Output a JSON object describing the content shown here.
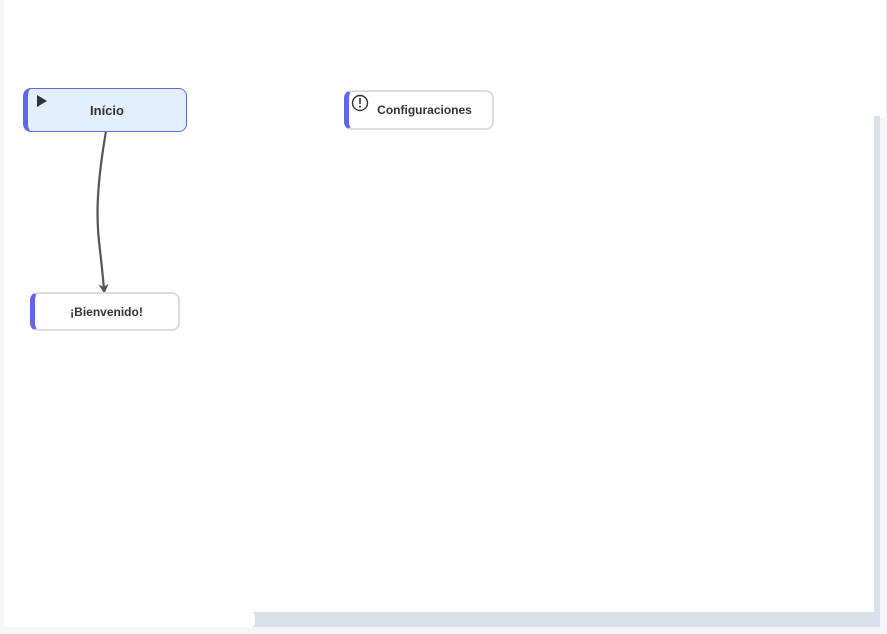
{
  "diagram": {
    "nodes": [
      {
        "id": "start",
        "label": "Início",
        "icon": "play-icon",
        "type": "start"
      },
      {
        "id": "settings",
        "label": "Configuraciones",
        "icon": "alert-circle-icon",
        "type": "block"
      },
      {
        "id": "welcome",
        "label": "¡Bienvenido!",
        "icon": "",
        "type": "block"
      }
    ],
    "edges": [
      {
        "from": "start",
        "to": "welcome"
      }
    ]
  },
  "colors": {
    "accent": "#6366e8",
    "start_fill": "#e3effc",
    "node_border": "#dcdcdc",
    "edge": "#555555",
    "scroll_track": "#d9e0e7"
  }
}
